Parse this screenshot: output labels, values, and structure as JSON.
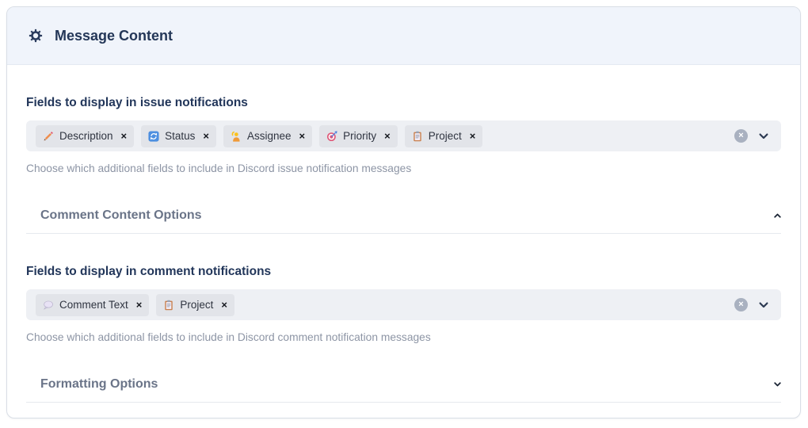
{
  "header": {
    "title": "Message Content"
  },
  "issue_fields": {
    "label": "Fields to display in issue notifications",
    "help": "Choose which additional fields to include in Discord issue notification messages",
    "tags": [
      {
        "icon": "pencil-icon",
        "label": "Description"
      },
      {
        "icon": "refresh-icon",
        "label": "Status"
      },
      {
        "icon": "raising-hand-icon",
        "label": "Assignee"
      },
      {
        "icon": "target-icon",
        "label": "Priority"
      },
      {
        "icon": "clipboard-icon",
        "label": "Project"
      }
    ]
  },
  "comment_options_section": {
    "title": "Comment Content Options",
    "chevron": "up"
  },
  "comment_fields": {
    "label": "Fields to display in comment notifications",
    "help": "Choose which additional fields to include in Discord comment notification messages",
    "tags": [
      {
        "icon": "speech-balloon-icon",
        "label": "Comment Text"
      },
      {
        "icon": "clipboard-icon",
        "label": "Project"
      }
    ]
  },
  "formatting_section": {
    "title": "Formatting Options",
    "chevron": "down"
  },
  "glyphs": {
    "tag_remove": "×",
    "clear_all": "×"
  },
  "colors": {
    "header_bg": "#f0f4fb",
    "title": "#243758",
    "label": "#22365a",
    "muted_text": "#8d95a5",
    "section_title": "#6a7488",
    "select_bg": "#eef0f4",
    "tag_bg": "#e2e4e9",
    "clear_circle": "#a9b1c0",
    "chevron": "#2c3a52"
  }
}
